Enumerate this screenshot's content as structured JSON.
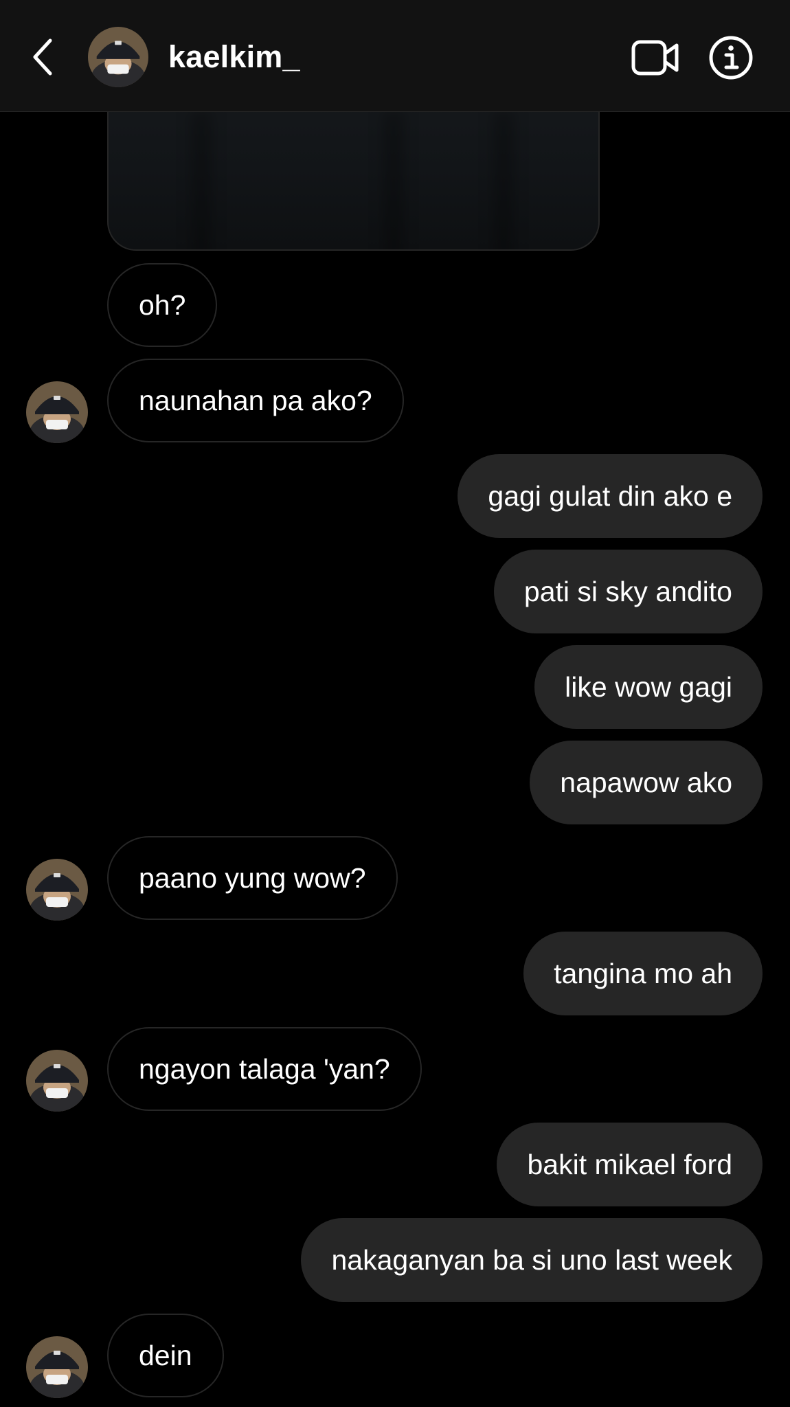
{
  "header": {
    "username": "kaelkim_",
    "back_icon": "chevron-left-icon",
    "video_icon": "video-call-icon",
    "info_icon": "info-icon"
  },
  "colors": {
    "background": "#000000",
    "header_background": "#121212",
    "outgoing_bubble": "#262626",
    "incoming_border": "#262626",
    "text": "#ffffff"
  },
  "messages": [
    {
      "direction": "incoming",
      "text": "oh?",
      "show_avatar": false
    },
    {
      "direction": "incoming",
      "text": "naunahan pa ako?",
      "show_avatar": true
    },
    {
      "direction": "outgoing",
      "text": "gagi gulat din ako e"
    },
    {
      "direction": "outgoing",
      "text": "pati si sky andito"
    },
    {
      "direction": "outgoing",
      "text": "like wow gagi"
    },
    {
      "direction": "outgoing",
      "text": "napawow ako"
    },
    {
      "direction": "incoming",
      "text": "paano yung wow?",
      "show_avatar": true
    },
    {
      "direction": "outgoing",
      "text": "tangina mo ah"
    },
    {
      "direction": "incoming",
      "text": "ngayon talaga 'yan?",
      "show_avatar": true
    },
    {
      "direction": "outgoing",
      "text": "bakit mikael ford"
    },
    {
      "direction": "outgoing",
      "text": "nakaganyan ba si uno last week"
    },
    {
      "direction": "incoming",
      "text": "dein",
      "show_avatar": true
    }
  ]
}
